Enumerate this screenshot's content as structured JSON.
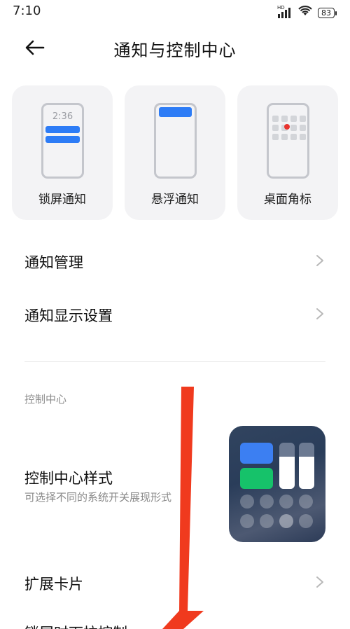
{
  "status_bar": {
    "time": "7:10",
    "network": "HD",
    "battery": "83"
  },
  "header": {
    "title": "通知与控制中心"
  },
  "cards": [
    {
      "label": "锁屏通知",
      "lock_time": "2:36"
    },
    {
      "label": "悬浮通知"
    },
    {
      "label": "桌面角标"
    }
  ],
  "rows": {
    "notification_management": "通知管理",
    "notification_display": "通知显示设置",
    "section_label": "控制中心",
    "control_center_style": "控制中心样式",
    "control_center_style_sub": "可选择不同的系统开关展现形式",
    "expand_cards": "扩展卡片",
    "partial_row": "锁屏时下拉控制"
  },
  "cc_preview": {
    "slider_levels": [
      0.7,
      0.7
    ]
  },
  "colors": {
    "accent_blue": "#2d7cf6",
    "badge_red": "#e8342f",
    "green": "#16c26a",
    "annotation_arrow": "#f03a1e"
  }
}
